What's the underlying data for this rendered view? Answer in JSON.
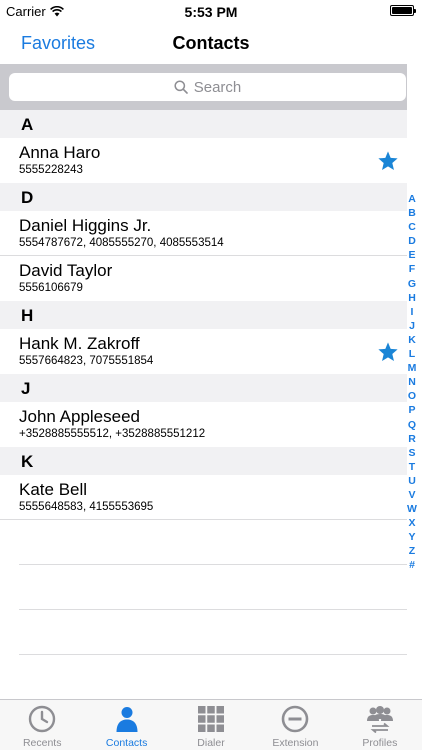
{
  "status_bar": {
    "carrier": "Carrier",
    "time": "5:53 PM"
  },
  "nav": {
    "left_button": "Favorites",
    "title": "Contacts"
  },
  "search": {
    "placeholder": "Search"
  },
  "sections": [
    {
      "letter": "A",
      "contacts": [
        {
          "name": "Anna Haro",
          "phones": "5555228243",
          "favorite": true
        }
      ]
    },
    {
      "letter": "D",
      "contacts": [
        {
          "name": "Daniel Higgins Jr.",
          "phones": "5554787672, 4085555270, 4085553514",
          "favorite": false
        },
        {
          "name": "David Taylor",
          "phones": "5556106679",
          "favorite": false
        }
      ]
    },
    {
      "letter": "H",
      "contacts": [
        {
          "name": "Hank M. Zakroff",
          "phones": "5557664823, 7075551854",
          "favorite": true
        }
      ]
    },
    {
      "letter": "J",
      "contacts": [
        {
          "name": "John Appleseed",
          "phones": "+3528885555512, +3528885551212",
          "favorite": false
        }
      ]
    },
    {
      "letter": "K",
      "contacts": [
        {
          "name": "Kate Bell",
          "phones": "5555648583, 4155553695",
          "favorite": false
        }
      ]
    }
  ],
  "index_letters": [
    "A",
    "B",
    "C",
    "D",
    "E",
    "F",
    "G",
    "H",
    "I",
    "J",
    "K",
    "L",
    "M",
    "N",
    "O",
    "P",
    "Q",
    "R",
    "S",
    "T",
    "U",
    "V",
    "W",
    "X",
    "Y",
    "Z",
    "#"
  ],
  "tabs": [
    {
      "label": "Recents",
      "icon": "clock-icon",
      "active": false
    },
    {
      "label": "Contacts",
      "icon": "person-icon",
      "active": true
    },
    {
      "label": "Dialer",
      "icon": "keypad-icon",
      "active": false
    },
    {
      "label": "Extension",
      "icon": "minus-circle-icon",
      "active": false
    },
    {
      "label": "Profiles",
      "icon": "profiles-icon",
      "active": false
    }
  ],
  "colors": {
    "accent": "#1a7be0",
    "inactive": "#8e8e93",
    "star": "#1a85d6"
  }
}
